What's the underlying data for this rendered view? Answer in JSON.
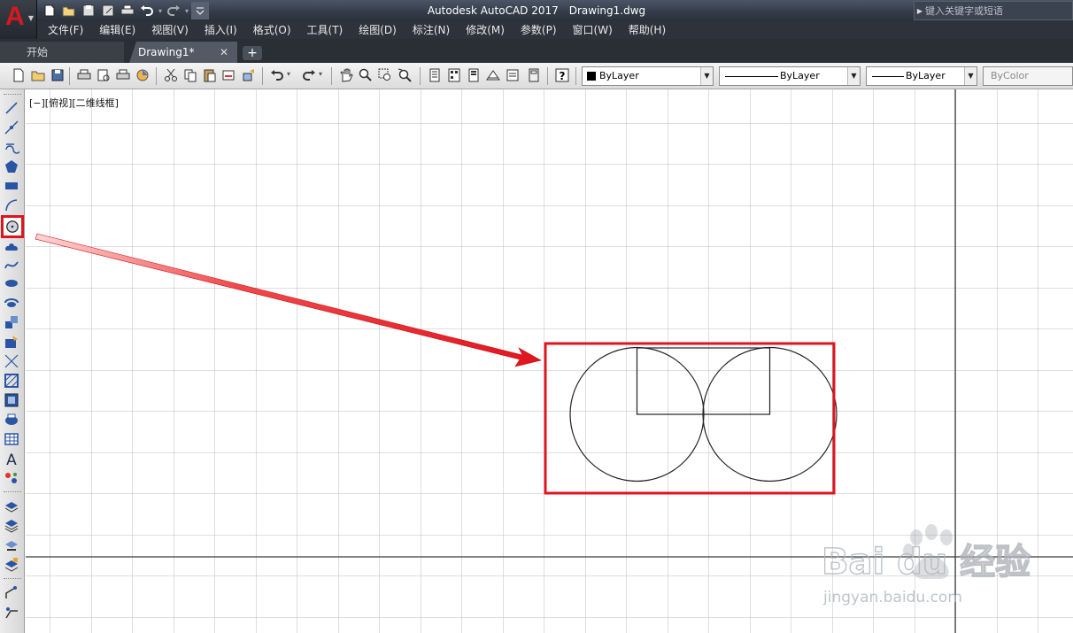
{
  "app": {
    "logo_letter": "A",
    "title": "Autodesk AutoCAD 2017",
    "filename": "Drawing1.dwg",
    "search_placeholder": "键入关键字或短语"
  },
  "menu": [
    "文件(F)",
    "编辑(E)",
    "视图(V)",
    "插入(I)",
    "格式(O)",
    "工具(T)",
    "绘图(D)",
    "标注(N)",
    "修改(M)",
    "参数(P)",
    "窗口(W)",
    "帮助(H)"
  ],
  "tabs": {
    "start": "开始",
    "drawing": "Drawing1*",
    "close_symbol": "✕",
    "add_symbol": "+"
  },
  "properties": {
    "color": "ByLayer",
    "linetype": "ByLayer",
    "lineweight": "ByLayer",
    "plotstyle": "ByColor"
  },
  "viewport": {
    "label": "[−][俯视][二维线框]"
  },
  "toolbar_icons": [
    "qnew-icon",
    "open-icon",
    "save-icon",
    "plot-icon",
    "plot-preview-icon",
    "publish-icon",
    "3d-print-icon",
    "cut-icon",
    "copy-icon",
    "paste-icon",
    "match-properties-icon",
    "block-editor-icon",
    "undo-icon",
    "redo-icon",
    "pan-icon",
    "zoom-realtime-icon",
    "zoom-window-icon",
    "zoom-previous-icon",
    "properties-icon",
    "design-center-icon",
    "tool-palettes-icon",
    "sheet-set-icon",
    "markup-icon",
    "quickcalc-icon",
    "help-icon"
  ],
  "draw_icons": [
    "line-icon",
    "construction-line-icon",
    "polyline-icon",
    "polygon-icon",
    "rectangle-icon",
    "arc-icon",
    "circle-icon",
    "revision-cloud-icon",
    "spline-icon",
    "ellipse-icon",
    "ellipse-arc-icon",
    "insert-block-icon",
    "make-block-icon",
    "point-icon",
    "hatch-icon",
    "gradient-icon",
    "region-icon",
    "table-icon",
    "mtext-icon",
    "add-selected-icon",
    "layer-icon",
    "layer-states-icon",
    "layer-previous-icon",
    "layer-isolate-icon",
    "dimension-icon",
    "leader-icon"
  ],
  "watermark": {
    "brand": "Bai du 经验",
    "url": "jingyan.baidu.com"
  },
  "colors": {
    "highlight": "#e0141e",
    "grid_minor": "#b8bcc4",
    "grid_major": "#3a3a3a"
  }
}
